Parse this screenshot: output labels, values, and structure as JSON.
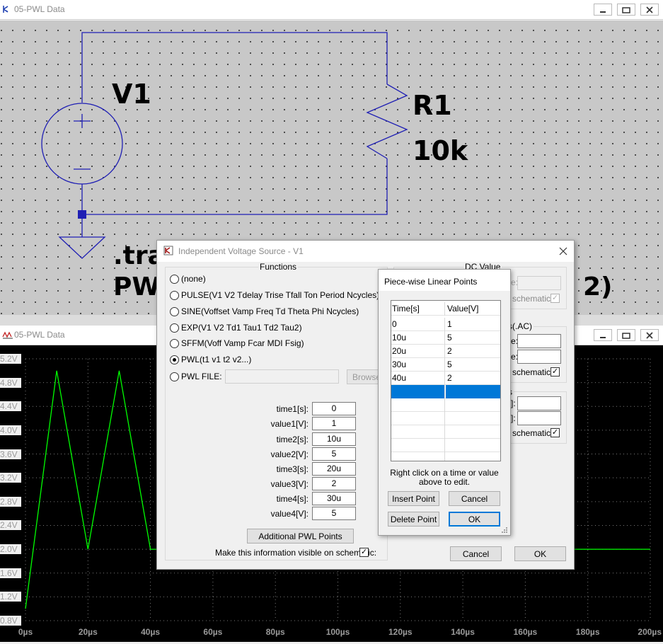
{
  "schematic_window": {
    "title": "05-PWL Data"
  },
  "schematic": {
    "source_label": "V1",
    "resistor_label": "R1",
    "resistor_value": "10k",
    "directive_line1": ".tra",
    "directive_line2": "PW",
    "directive_tail": "2)"
  },
  "plot_window": {
    "title": "05-PWL Data"
  },
  "plot": {
    "y_ticks": [
      "5.2V",
      "4.8V",
      "4.4V",
      "4.0V",
      "3.6V",
      "3.2V",
      "2.8V",
      "2.4V",
      "2.0V",
      "1.6V",
      "1.2V",
      "0.8V"
    ],
    "x_ticks": [
      "0µs",
      "20µs",
      "40µs",
      "60µs",
      "80µs",
      "100µs",
      "120µs",
      "140µs",
      "160µs",
      "180µs",
      "200µs"
    ],
    "trace_color": "#00ff00"
  },
  "chart_data": {
    "type": "line",
    "xlabel": "",
    "ylabel": "",
    "xlim": [
      0,
      200
    ],
    "ylim": [
      0.8,
      5.2
    ],
    "series": [
      {
        "x": [
          0,
          10,
          20,
          30,
          40,
          200
        ],
        "y": [
          1,
          5,
          2,
          5,
          2,
          2
        ]
      }
    ]
  },
  "dialog": {
    "title": "Independent Voltage Source - V1",
    "functions_label": "Functions",
    "radios": [
      {
        "label": "(none)",
        "selected": false
      },
      {
        "label": "PULSE(V1 V2 Tdelay Trise Tfall Ton Period Ncycles)",
        "selected": false
      },
      {
        "label": "SINE(Voffset Vamp Freq Td Theta Phi Ncycles)",
        "selected": false
      },
      {
        "label": "EXP(V1 V2 Td1 Tau1 Td2 Tau2)",
        "selected": false
      },
      {
        "label": "SFFM(Voff Vamp Fcar MDI Fsig)",
        "selected": false
      },
      {
        "label": "PWL(t1 v1 t2 v2...)",
        "selected": true
      },
      {
        "label": "PWL FILE:",
        "selected": false
      }
    ],
    "browse_label": "Browse",
    "fields": [
      {
        "label": "time1[s]:",
        "value": "0"
      },
      {
        "label": "value1[V]:",
        "value": "1"
      },
      {
        "label": "time2[s]:",
        "value": "10u"
      },
      {
        "label": "value2[V]:",
        "value": "5"
      },
      {
        "label": "time3[s]:",
        "value": "20u"
      },
      {
        "label": "value3[V]:",
        "value": "2"
      },
      {
        "label": "time4[s]:",
        "value": "30u"
      },
      {
        "label": "value4[V]:",
        "value": "5"
      }
    ],
    "additional_button": "Additional PWL Points",
    "visible_text": "Make this information visible on schematic:",
    "dc_value_label": "DC Value",
    "dc_partial_e": "e:",
    "dc_schematic": "schematic:",
    "ac_partial": "s(.AC)",
    "ac_e1": "e:",
    "ac_e2": "e:",
    "ac_schematic": "schematic:",
    "p_partial": "s",
    "p_e1": "]:",
    "p_e2": "]:",
    "p_schematic": "schematic:",
    "cancel": "Cancel",
    "ok": "OK"
  },
  "pwl_dialog": {
    "title": "Piece-wise Linear Points",
    "col_time": "Time[s]",
    "col_value": "Value[V]",
    "rows": [
      {
        "time": "0",
        "value": "1"
      },
      {
        "time": "10u",
        "value": "5"
      },
      {
        "time": "20u",
        "value": "2"
      },
      {
        "time": "30u",
        "value": "5"
      },
      {
        "time": "40u",
        "value": "2"
      }
    ],
    "hint_line1": "Right click on a time or value",
    "hint_line2": "above to edit.",
    "insert": "Insert Point",
    "cancel": "Cancel",
    "delete": "Delete Point",
    "ok": "OK"
  }
}
